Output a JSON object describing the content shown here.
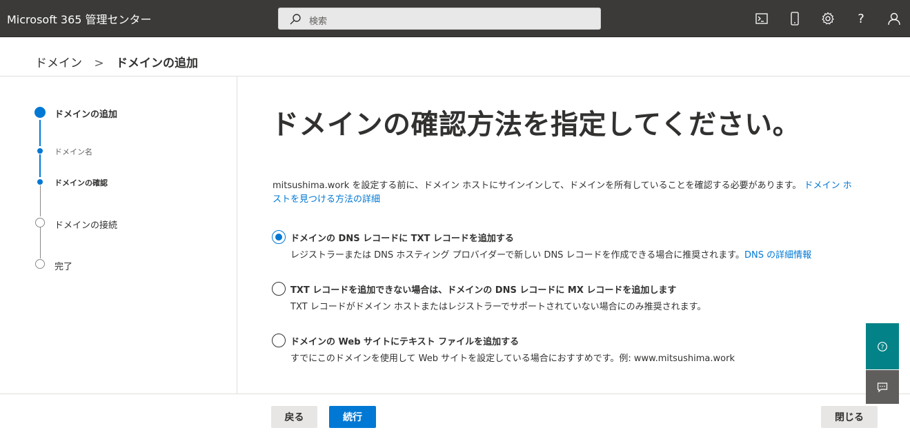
{
  "app": {
    "title": "Microsoft 365 管理センター",
    "search_placeholder": "検索",
    "icons": [
      "terminal-icon",
      "mobile-icon",
      "gear-icon",
      "help-icon",
      "user-icon"
    ]
  },
  "breadcrumb": {
    "root": "ドメイン",
    "separator": ">",
    "current": "ドメインの追加"
  },
  "steps": [
    {
      "label": "ドメインの追加",
      "state": "active"
    },
    {
      "label": "ドメイン名",
      "state": "done-sub"
    },
    {
      "label": "ドメインの確認",
      "state": "current-sub"
    },
    {
      "label": "ドメインの接続",
      "state": "pending"
    },
    {
      "label": "完了",
      "state": "pending"
    }
  ],
  "main": {
    "title": "ドメインの確認方法を指定してください。",
    "intro": "mitsushima.work を設定する前に、ドメイン ホストにサインインして、ドメインを所有していることを確認する必要があります。",
    "intro_link_line1": "ドメイン ホ",
    "intro_link_line2": "ストを見つける方法の詳細",
    "options": [
      {
        "title": "ドメインの DNS レコードに TXT レコードを追加する",
        "desc": "レジストラーまたは DNS ホスティング プロバイダーで新しい DNS レコードを作成できる場合に推奨されます。",
        "link": "DNS の詳細情報",
        "selected": true
      },
      {
        "title": "TXT レコードを追加できない場合は、ドメインの DNS レコードに MX レコードを追加します",
        "desc": "TXT レコードがドメイン ホストまたはレジストラーでサポートされていない場合にのみ推奨されます。",
        "selected": false
      },
      {
        "title": "ドメインの Web サイトにテキスト ファイルを追加する",
        "desc": "すでにこのドメインを使用して Web サイトを設定している場合におすすめです。例: www.mitsushima.work",
        "selected": false
      }
    ]
  },
  "footer": {
    "back_label": "戻る",
    "next_label": "続行",
    "close_label": "閉じる"
  },
  "colors": {
    "topbar": "#3b3a39",
    "accent": "#0078d4",
    "help_button": "#038387",
    "feedback_button": "#605e5c"
  }
}
